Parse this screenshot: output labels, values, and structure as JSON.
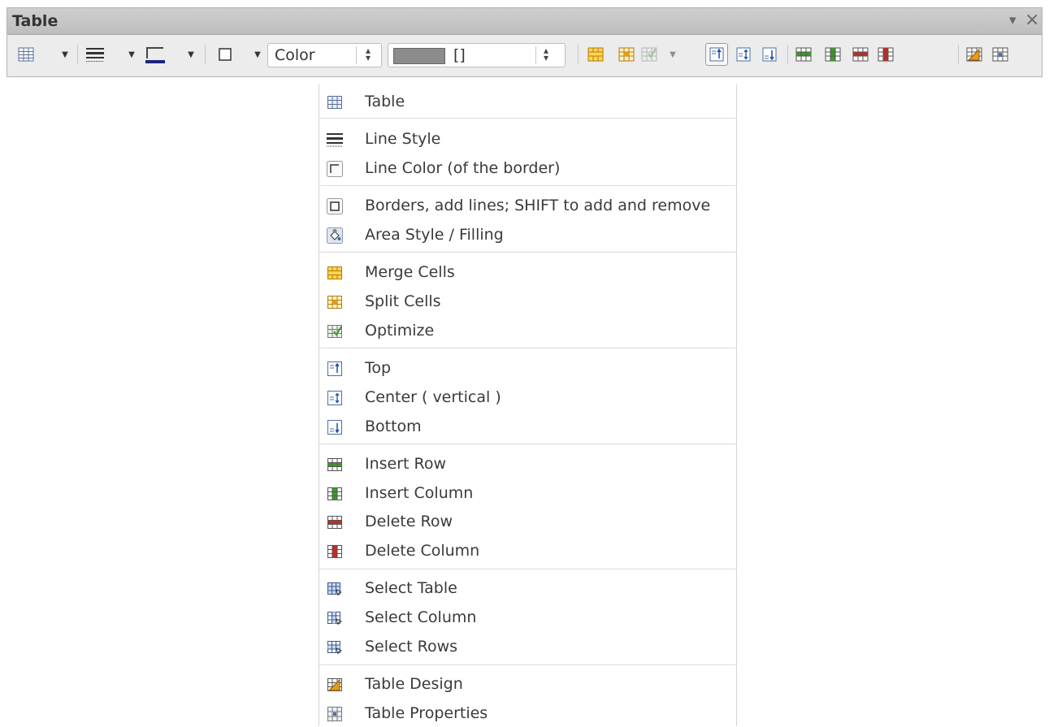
{
  "toolbar": {
    "title": "Table",
    "menu_glyph": "▾",
    "close_glyph": "×",
    "area_style_value": "Color",
    "fill_value": "[]",
    "spin_glyph": "⬍"
  },
  "menu": {
    "items": [
      {
        "label": "Table",
        "icon": "table-icon"
      },
      {
        "label": "Line Style",
        "icon": "line-style-icon"
      },
      {
        "label": "Line Color (of the border)",
        "icon": "line-color-icon"
      },
      {
        "label": "Borders, add lines; SHIFT to add and remove",
        "icon": "borders-icon"
      },
      {
        "label": "Area Style / Filling",
        "icon": "area-style-icon"
      },
      {
        "label": "Merge Cells",
        "icon": "merge-cells-icon"
      },
      {
        "label": "Split Cells",
        "icon": "split-cells-icon"
      },
      {
        "label": "Optimize",
        "icon": "optimize-icon"
      },
      {
        "label": "Top",
        "icon": "align-top-icon"
      },
      {
        "label": "Center ( vertical )",
        "icon": "align-center-icon"
      },
      {
        "label": "Bottom",
        "icon": "align-bottom-icon"
      },
      {
        "label": "Insert Row",
        "icon": "insert-row-icon"
      },
      {
        "label": "Insert Column",
        "icon": "insert-column-icon"
      },
      {
        "label": "Delete Row",
        "icon": "delete-row-icon"
      },
      {
        "label": "Delete Column",
        "icon": "delete-column-icon"
      },
      {
        "label": "Select Table",
        "icon": "select-table-icon"
      },
      {
        "label": "Select Column",
        "icon": "select-column-icon"
      },
      {
        "label": "Select Rows",
        "icon": "select-rows-icon"
      },
      {
        "label": "Table Design",
        "icon": "table-design-icon"
      },
      {
        "label": "Table Properties",
        "icon": "table-properties-icon"
      }
    ]
  },
  "colors": {
    "title_bar": "#c6c6c6",
    "toolbar_bg": "#ececec",
    "line_color_swatch": "#1a237e",
    "insert_green": "#3a9a2a",
    "delete_red": "#c62828",
    "merge_orange": "#e89a1a"
  }
}
